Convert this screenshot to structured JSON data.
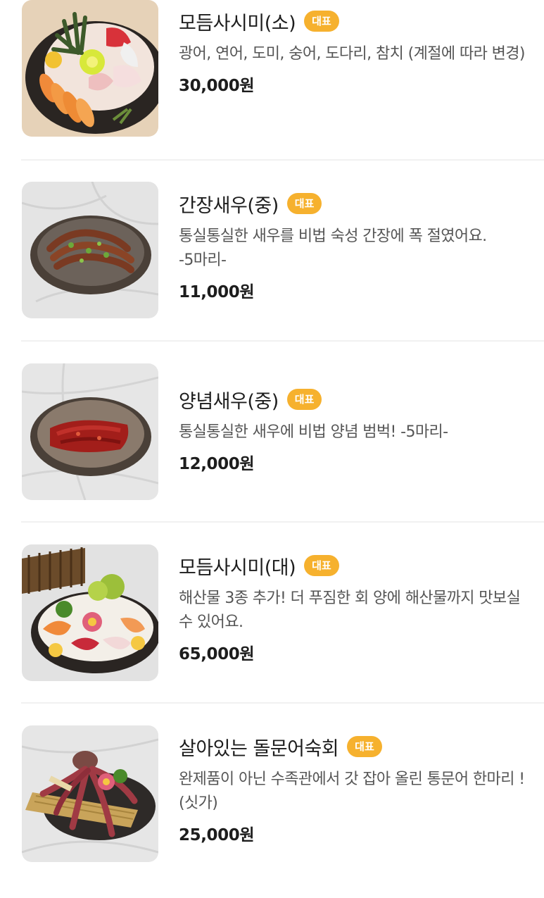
{
  "menu": {
    "items": [
      {
        "name": "모듬사시미(소)",
        "badge": "대표",
        "description": "광어, 연어, 도미, 숭어, 도다리, 참치 (계절에 따라 변경)",
        "price": "30,000원",
        "image_icon": "sashimi-platter-photo"
      },
      {
        "name": "간장새우(중)",
        "badge": "대표",
        "description": "통실통실한 새우를 비법 숙성 간장에 폭 절였어요. -5마리-",
        "price": "11,000원",
        "image_icon": "soy-shrimp-photo"
      },
      {
        "name": "양념새우(중)",
        "badge": "대표",
        "description": "통실통실한 새우에 비법 양념 범벅! -5마리-",
        "price": "12,000원",
        "image_icon": "spicy-shrimp-photo"
      },
      {
        "name": "모듬사시미(대)",
        "badge": "대표",
        "description": "해산물 3종 추가! 더 푸짐한 회 양에 해산물까지 맛보실 수 있어요.",
        "price": "65,000원",
        "image_icon": "large-sashimi-platter-photo"
      },
      {
        "name": "살아있는 돌문어숙회",
        "badge": "대표",
        "description": "완제품이 아닌 수족관에서 갓 잡아 올린 통문어 한마리 ! (싯가)",
        "price": "25,000원",
        "image_icon": "octopus-photo"
      }
    ]
  },
  "colors": {
    "badge_bg": "#f6b12e",
    "text_primary": "#1d1d1d",
    "text_secondary": "#555555",
    "divider": "#f1f1f1"
  }
}
